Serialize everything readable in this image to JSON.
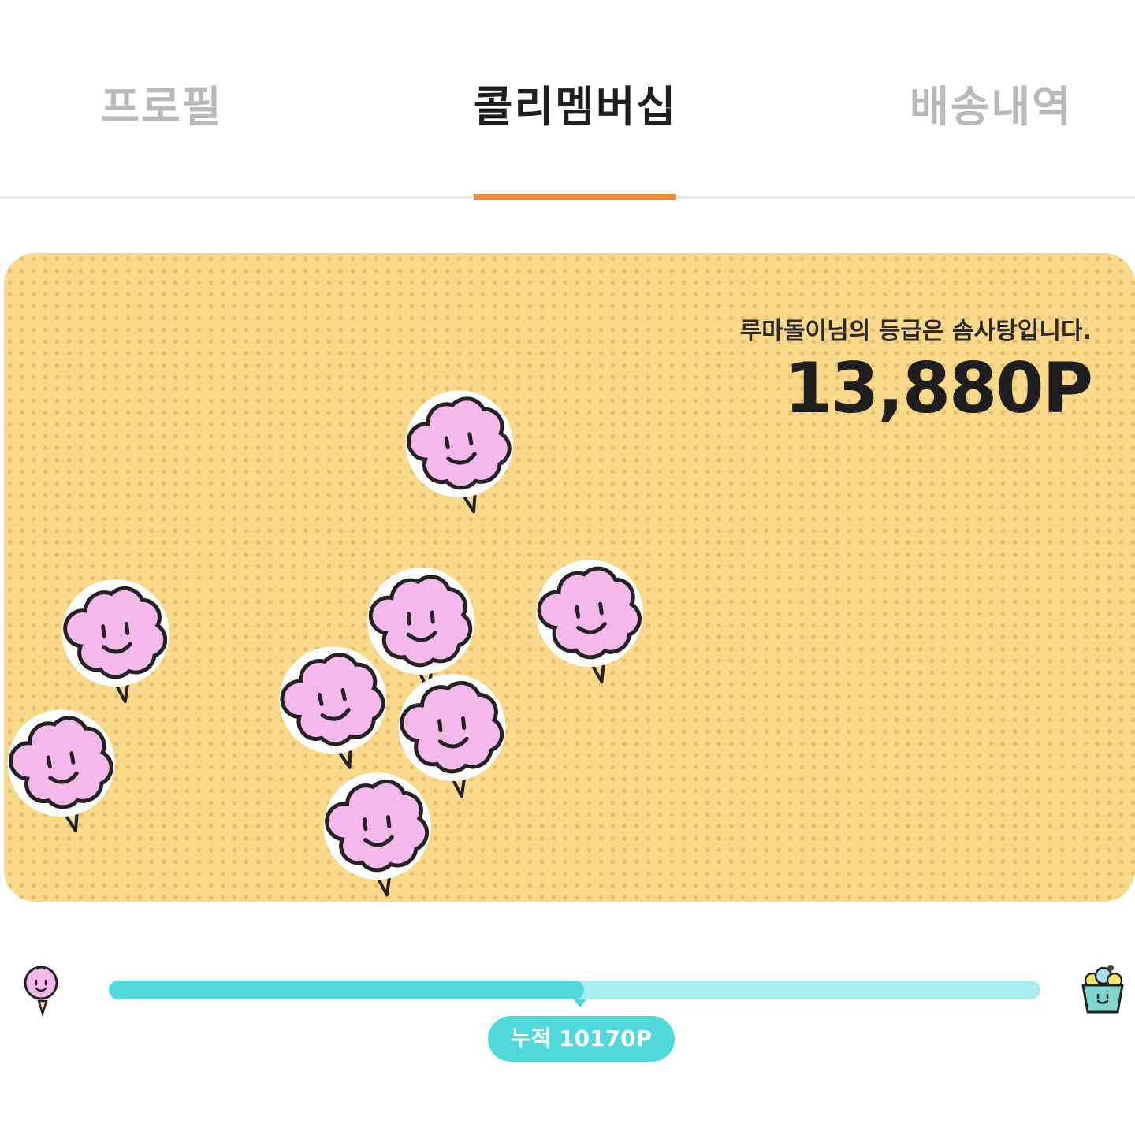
{
  "tabs": [
    {
      "label": "프로필",
      "active": false
    },
    {
      "label": "콜리멤버십",
      "active": true
    },
    {
      "label": "배송내역",
      "active": false
    }
  ],
  "colors": {
    "accent": "#f28a3b",
    "card_background": "#f9d98a",
    "progress_fill": "#4fd9db",
    "progress_track": "#a8eef0",
    "candy_pink": "#f5b8ea"
  },
  "membership": {
    "grade_message": "루마돌이님의 등급은 솜사탕입니다.",
    "points": "13,880P",
    "card_icon": "cotton-candy-icon"
  },
  "progress": {
    "current_level_icon": "cotton-candy-icon",
    "next_level_icon": "popcorn-cup-icon",
    "fill_fraction": 0.51,
    "accumulated_label": "누적 10170P"
  }
}
